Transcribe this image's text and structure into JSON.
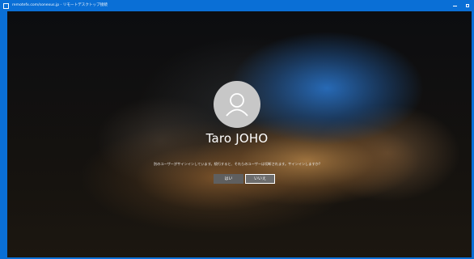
{
  "window": {
    "title": "remotefx.com/sonexus.jp - リモートデスクトップ接続",
    "colors": {
      "titlebar": "#0a6fd6"
    }
  },
  "login": {
    "username": "Taro JOHO",
    "message": "別のユーザーがサインインしています。続行すると、それらのユーザーは切断されます。サインインしますか?",
    "yes_label": "はい",
    "no_label": "いいえ",
    "avatar_icon": "user-icon"
  }
}
